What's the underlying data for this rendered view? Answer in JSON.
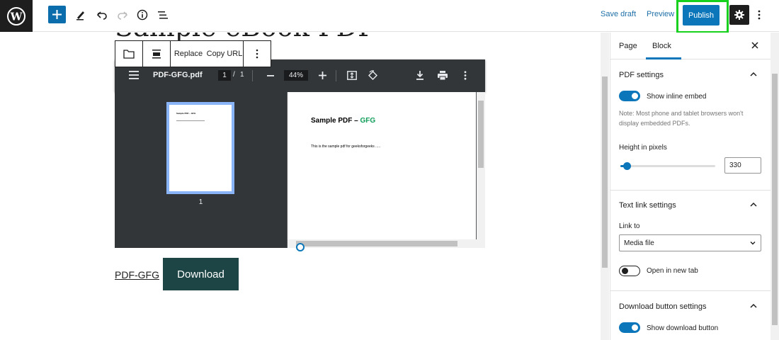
{
  "topbar": {
    "save_draft": "Save draft",
    "preview": "Preview",
    "publish": "Publish"
  },
  "editor": {
    "page_title": "Sample eBook PDF",
    "block_toolbar": {
      "replace": "Replace",
      "copy_url": "Copy URL"
    },
    "pdf_viewer": {
      "filename": "PDF-GFG.pdf",
      "current_page": "1",
      "page_separator": "/",
      "total_pages": "1",
      "zoom": "44%",
      "thumbnail_page_number": "1",
      "doc_heading": "Sample PDF – ",
      "doc_heading_accent": "GFG",
      "doc_body": "This is the sample pdf for geeksforgeeks .....",
      "thumb_heading": "Sample PDF – GFG"
    },
    "file_link": "PDF-GFG",
    "download_button": "Download"
  },
  "sidebar": {
    "tabs": [
      "Page",
      "Block"
    ],
    "active_tab": "Block",
    "pdf_settings": {
      "title": "PDF settings",
      "show_inline_embed": "Show inline embed",
      "show_inline_embed_on": true,
      "note": "Note: Most phone and tablet browsers won't display embedded PDFs.",
      "height_label": "Height in pixels",
      "height_value": "330",
      "height_slider_fraction": 0.07
    },
    "text_link_settings": {
      "title": "Text link settings",
      "link_to_label": "Link to",
      "link_to_value": "Media file",
      "open_new_tab": "Open in new tab",
      "open_new_tab_on": false
    },
    "download_button_settings": {
      "title": "Download button settings",
      "show_download_button": "Show download button",
      "show_download_button_on": true
    }
  },
  "colors": {
    "accent": "#0c76ba",
    "publish_highlight": "#18d11e",
    "download_bg": "#1e4545",
    "gfg_green": "#0f9d58",
    "wp_dark": "#1e1e1e"
  }
}
